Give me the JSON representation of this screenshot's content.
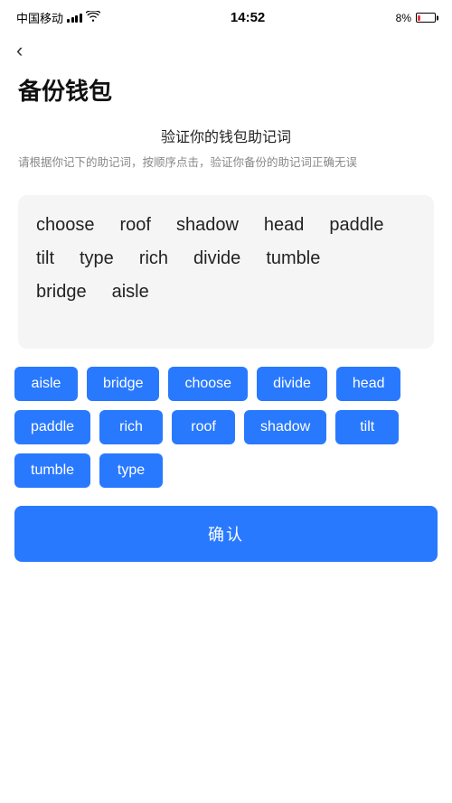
{
  "statusBar": {
    "carrier": "中国移动",
    "time": "14:52",
    "battery_pct": "8%"
  },
  "header": {
    "back_label": "‹",
    "title": "备份钱包"
  },
  "verifySection": {
    "title": "验证你的钱包助记词",
    "description": "请根据你记下的助记词，按顺序点击，验证你备份的助记词正确无误"
  },
  "displayWords": [
    "choose",
    "roof",
    "shadow",
    "head",
    "paddle",
    "tilt",
    "type",
    "rich",
    "divide",
    "tumble",
    "bridge",
    "aisle"
  ],
  "selectableWords": [
    "aisle",
    "bridge",
    "choose",
    "divide",
    "head",
    "paddle",
    "rich",
    "roof",
    "shadow",
    "tilt",
    "tumble",
    "type"
  ],
  "confirmButton": {
    "label": "确认"
  }
}
